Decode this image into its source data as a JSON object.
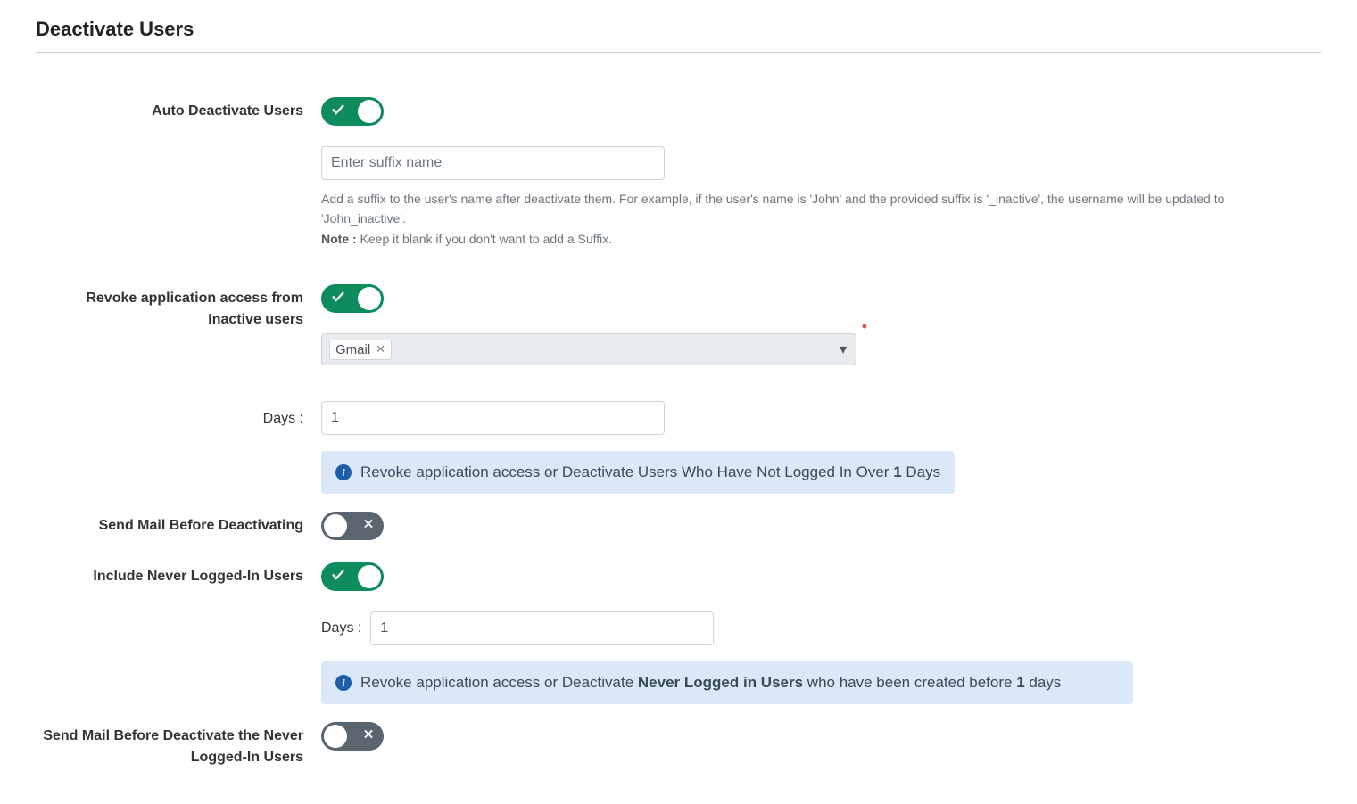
{
  "page": {
    "title": "Deactivate Users"
  },
  "autoDeactivate": {
    "label": "Auto Deactivate Users",
    "enabled": true,
    "suffixPlaceholder": "Enter suffix name",
    "help1": "Add a suffix to the user's name after deactivate them. For example, if the user's name is 'John' and the provided suffix is '_inactive', the username will be updated to 'John_inactive'.",
    "noteLabel": "Note :",
    "noteText": " Keep it blank if you don't want to add a Suffix."
  },
  "revokeAccess": {
    "label": "Revoke application access from Inactive users",
    "enabled": true,
    "selectedApp": "Gmail",
    "daysLabel": "Days :",
    "daysValue": "1",
    "infoPrefix": "Revoke application access or Deactivate Users Who Have Not Logged In Over ",
    "infoBold": "1",
    "infoSuffix": " Days"
  },
  "sendMailBefore": {
    "label": "Send Mail Before Deactivating",
    "enabled": false
  },
  "includeNeverLogged": {
    "label": "Include Never Logged-In Users",
    "enabled": true,
    "daysLabel": "Days :",
    "daysValue": "1",
    "infoPrefix": "Revoke application access or Deactivate ",
    "infoBold1": "Never Logged in Users",
    "infoMid": " who have been created before ",
    "infoBold2": "1",
    "infoSuffix": " days"
  },
  "sendMailNever": {
    "label": "Send Mail Before Deactivate the Never Logged-In Users",
    "enabled": false
  }
}
